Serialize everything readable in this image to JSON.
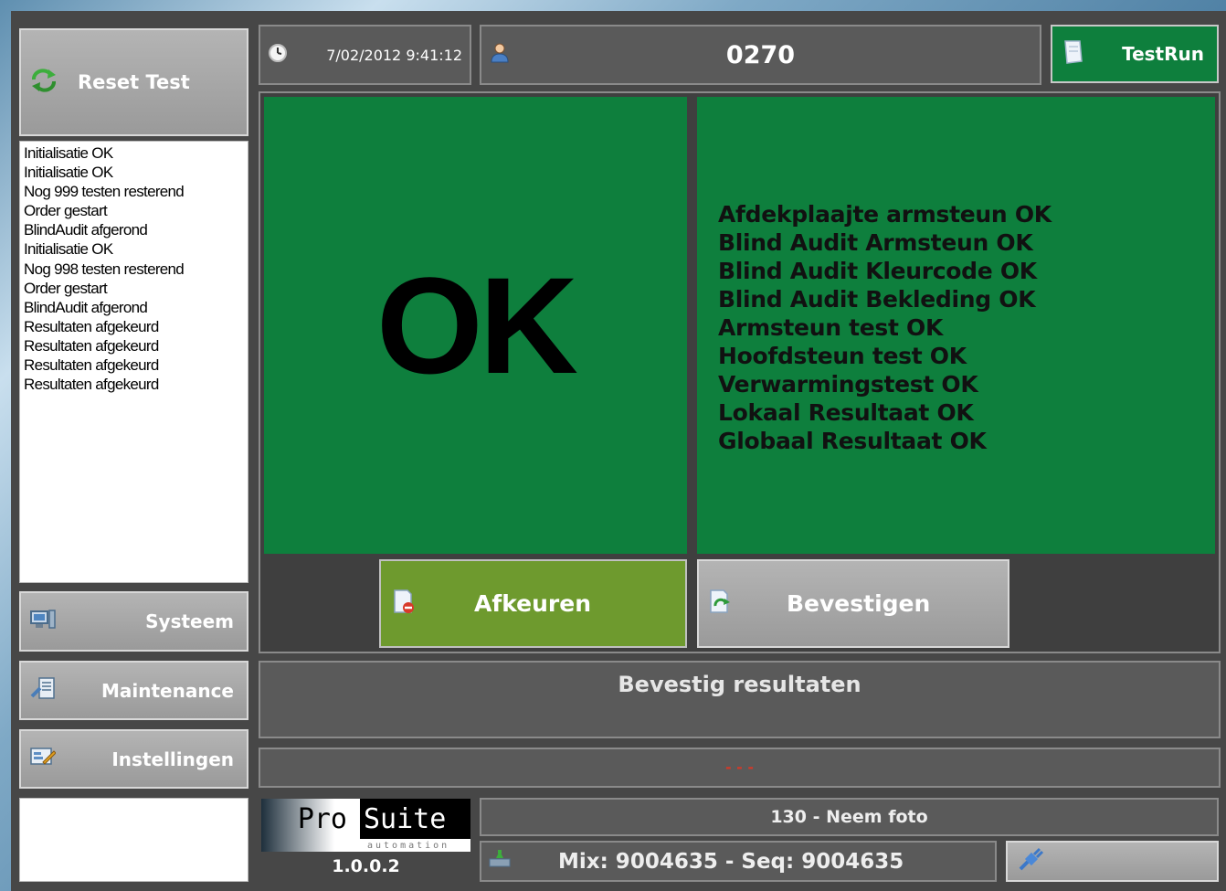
{
  "sidebar": {
    "reset_label": "Reset Test",
    "log": [
      "Initialisatie OK",
      "Initialisatie OK",
      "Nog 999 testen resterend",
      "Order gestart",
      "BlindAudit afgerond",
      "Initialisatie OK",
      "Nog 998 testen resterend",
      "Order gestart",
      "BlindAudit afgerond",
      "Resultaten afgekeurd",
      "Resultaten afgekeurd",
      "Resultaten afgekeurd",
      "Resultaten afgekeurd"
    ],
    "systeem_label": "Systeem",
    "maintenance_label": "Maintenance",
    "instellingen_label": "Instellingen"
  },
  "header": {
    "datetime": "7/02/2012 9:41:12",
    "operator_id": "0270",
    "testrun_label": "TestRun"
  },
  "main": {
    "status": "OK",
    "results": [
      "Afdekplaajte armsteun OK",
      "Blind Audit Armsteun OK",
      "Blind Audit Kleurcode OK",
      "Blind Audit Bekleding OK",
      "Armsteun test OK",
      "Hoofdsteun test OK",
      "Verwarmingstest OK",
      "Lokaal Resultaat OK",
      "Globaal Resultaat OK"
    ],
    "reject_label": "Afkeuren",
    "confirm_label": "Bevestigen",
    "message": "Bevestig resultaten",
    "sub_message": "- - -"
  },
  "footer": {
    "logo_pro": "Pro",
    "logo_suite": "Suite",
    "logo_tagline": "automation",
    "version": "1.0.0.2",
    "step": "130 - Neem foto",
    "mix_seq": "Mix: 9004635 - Seq: 9004635"
  },
  "colors": {
    "ok_green": "#0e7f3d",
    "reject_green": "#6e9a2e",
    "panel_gray": "#5a5a5a"
  }
}
